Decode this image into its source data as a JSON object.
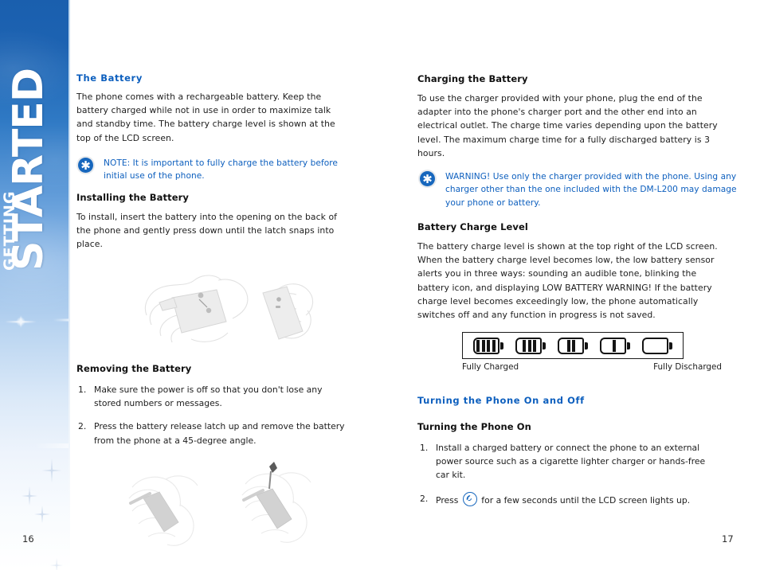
{
  "document": {
    "section_label_small": "GETTING",
    "section_label_large": "STARTED",
    "page_number_left": "16",
    "page_number_right": "17",
    "accent_blue": "#0d5fbe",
    "sidebar_top_blue": "#1a5fae",
    "note_icon_blue": "#1767bd",
    "body_text_color": "#1c1c1c"
  },
  "left_column": {
    "heading_battery": "The Battery",
    "para_battery": "The phone comes with a rechargeable battery. Keep the battery charged while not in use in order to maximize talk and standby time. The battery charge level is shown at the top of the LCD screen.",
    "note": {
      "icon": "asterisk-icon",
      "text": "NOTE: It is important to fully charge the battery before initial use of the phone."
    },
    "heading_installing": "Installing the Battery",
    "para_installing": "To install, insert the battery into the opening on the back of the phone and gently press down until the latch snaps into place.",
    "heading_removing": "Removing the Battery",
    "removing_steps": [
      {
        "num": "1.",
        "text": "Make sure the power is off so that you don't lose any stored numbers or messages."
      },
      {
        "num": "2.",
        "text": "Press the battery release latch up and remove the battery from the phone at a 45-degree angle."
      }
    ],
    "illustration_install_alt": "two hands inserting battery into back of phone",
    "illustration_remove_alt": "two hands removing battery from phone"
  },
  "right_column": {
    "heading_charging": "Charging the Battery",
    "para_charging": "To use the charger provided with your phone, plug the end of the adapter into the phone's charger port and the other end into an electrical outlet. The charge time varies depending upon the battery level. The maximum charge time for a fully discharged battery is 3 hours.",
    "warning": {
      "icon": "asterisk-icon",
      "text": "WARNING! Use only the charger provided with the phone. Using any charger other than the one included with the DM-L200 may damage your phone or battery."
    },
    "heading_charge_level": "Battery Charge Level",
    "para_charge_level": "The battery charge level is shown at the top right of the LCD screen. When the battery charge level becomes low, the low battery sensor alerts you in three ways: sounding an audible tone, blinking the battery icon, and displaying LOW BATTERY WARNING! If the battery charge level becomes exceedingly low, the phone automatically switches off and any function in progress is not saved.",
    "battery_diagram": {
      "levels": [
        4,
        3,
        2,
        1,
        0
      ],
      "label_left": "Fully Charged",
      "label_right": "Fully Discharged"
    },
    "heading_turning": "Turning the Phone On and Off",
    "heading_turning_on": "Turning the Phone On",
    "turning_on_steps": [
      {
        "num": "1.",
        "text": "Install a charged battery or connect the phone to an external power source such as a cigarette lighter charger or hands-free car kit."
      },
      {
        "num": "2.",
        "text_before": "Press",
        "icon": "power-key-icon",
        "text_after": "for a few seconds until the LCD screen lights up."
      }
    ]
  }
}
